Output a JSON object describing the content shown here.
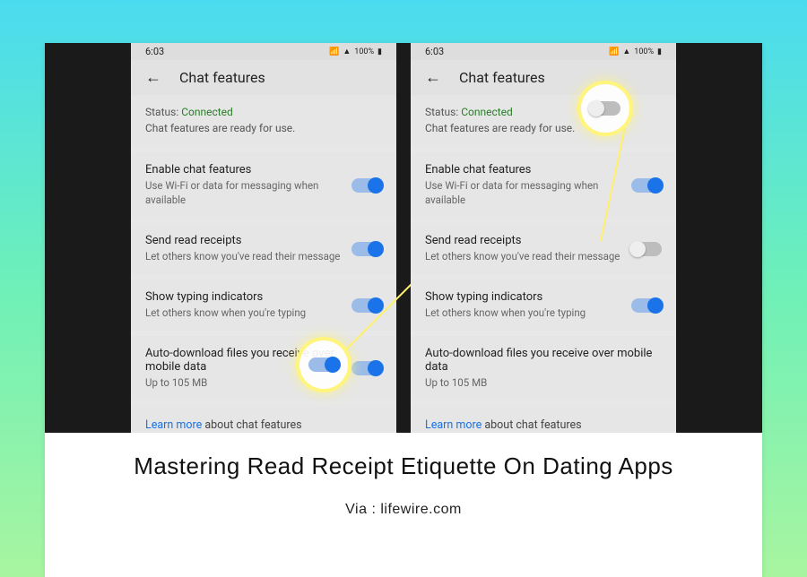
{
  "statusbar": {
    "time": "6:03",
    "battery": "100%"
  },
  "header": {
    "title": "Chat features"
  },
  "status": {
    "label": "Status: ",
    "value": "Connected",
    "sub": "Chat features are ready for use."
  },
  "settings": {
    "enable": {
      "title": "Enable chat features",
      "sub": "Use Wi-Fi or data for messaging when available"
    },
    "receipts": {
      "title": "Send read receipts",
      "sub": "Let others know you've read their message"
    },
    "typing": {
      "title": "Show typing indicators",
      "sub": "Let others know when you're typing"
    },
    "autodl": {
      "title": "Auto-download files you receive over mobile data",
      "sub": "Up to 105 MB"
    }
  },
  "learn": {
    "link": "Learn more",
    "rest": " about chat features"
  },
  "caption": {
    "title": "Mastering Read Receipt Etiquette On Dating Apps",
    "via": "Via : lifewire.com"
  }
}
